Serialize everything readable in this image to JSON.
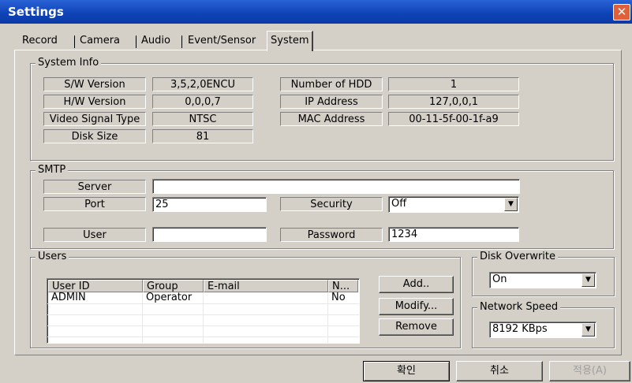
{
  "window": {
    "title": "Settings",
    "close_icon": "close-icon"
  },
  "tabs": [
    {
      "label": "Record"
    },
    {
      "label": "Camera"
    },
    {
      "label": "Audio"
    },
    {
      "label": "Event/Sensor"
    },
    {
      "label": "System",
      "active": true
    }
  ],
  "system_info": {
    "title": "System Info",
    "sw_version_label": "S/W Version",
    "sw_version": "3,5,2,0ENCU",
    "hw_version_label": "H/W Version",
    "hw_version": "0,0,0,7",
    "video_signal_label": "Video Signal Type",
    "video_signal": "NTSC",
    "disk_size_label": "Disk Size",
    "disk_size": "81",
    "hdd_count_label": "Number of HDD",
    "hdd_count": "1",
    "ip_label": "IP Address",
    "ip": "127,0,0,1",
    "mac_label": "MAC Address",
    "mac": "00-11-5f-00-1f-a9"
  },
  "smtp": {
    "title": "SMTP",
    "server_label": "Server",
    "server": "",
    "port_label": "Port",
    "port": "25",
    "security_label": "Security",
    "security": "Off",
    "user_label": "User",
    "user": "",
    "password_label": "Password",
    "password": "1234"
  },
  "users": {
    "title": "Users",
    "columns": [
      "User ID",
      "Group",
      "E-mail",
      "N..."
    ],
    "rows": [
      {
        "user_id": "ADMIN",
        "group": "Operator",
        "email": "",
        "n": "No"
      }
    ],
    "add_label": "Add..",
    "modify_label": "Modify...",
    "remove_label": "Remove"
  },
  "disk_overwrite": {
    "title": "Disk Overwrite",
    "value": "On"
  },
  "network_speed": {
    "title": "Network Speed",
    "value": "8192 KBps"
  },
  "footer": {
    "ok_label": "확인",
    "cancel_label": "취소",
    "apply_label": "적용(A)"
  }
}
